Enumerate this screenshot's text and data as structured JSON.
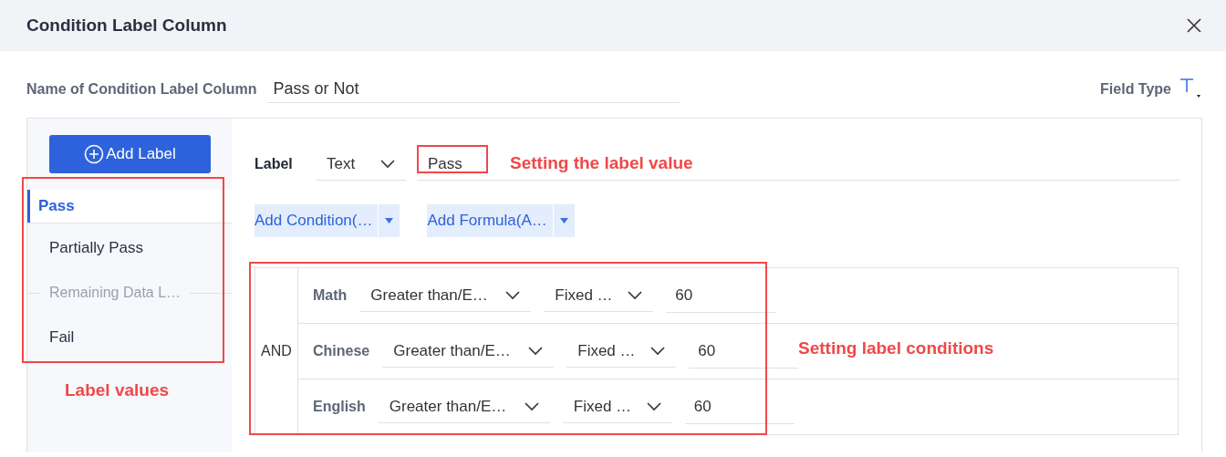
{
  "dialog": {
    "title": "Condition Label Column"
  },
  "name_field": {
    "label": "Name of Condition Label Column",
    "value": "Pass or Not"
  },
  "field_type": {
    "label": "Field Type"
  },
  "add_label_button": "Add Label",
  "label_list": [
    {
      "text": "Pass",
      "selected": true,
      "disabled": false
    },
    {
      "text": "Partially Pass",
      "selected": false,
      "disabled": false
    },
    {
      "text": "Remaining Data L…",
      "selected": false,
      "disabled": true
    },
    {
      "text": "Fail",
      "selected": false,
      "disabled": false
    }
  ],
  "label_editor": {
    "label": "Label",
    "type_select": "Text",
    "value": "Pass"
  },
  "action_buttons": [
    "Add Condition(…",
    "Add Formula(A…"
  ],
  "conditions": {
    "logic": "AND",
    "rows": [
      {
        "field": "Math",
        "operator": "Greater than/E…",
        "value_type": "Fixed …",
        "value": "60"
      },
      {
        "field": "Chinese",
        "operator": "Greater than/E…",
        "value_type": "Fixed …",
        "value": "60"
      },
      {
        "field": "English",
        "operator": "Greater than/E…",
        "value_type": "Fixed …",
        "value": "60"
      }
    ]
  },
  "annotations": [
    {
      "kind": "label_value",
      "text": "Setting the label value"
    },
    {
      "kind": "conditions",
      "text": "Setting label conditions"
    },
    {
      "kind": "label_list",
      "text": "Label values"
    }
  ]
}
